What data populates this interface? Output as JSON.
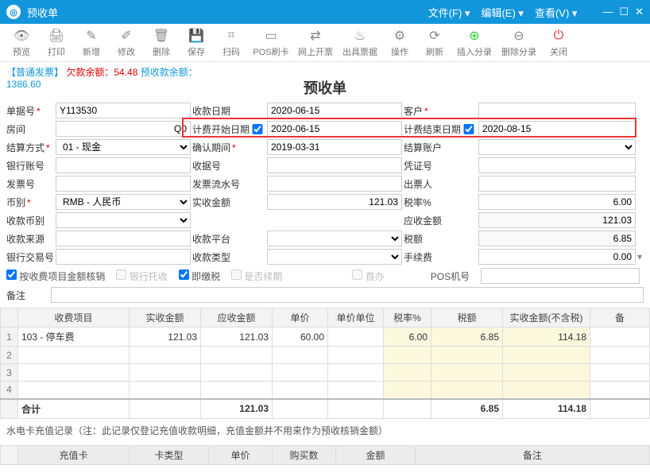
{
  "window": {
    "title": "预收单"
  },
  "menus": {
    "file": "文件(F)",
    "edit": "编辑(E)",
    "view": "查看(V)"
  },
  "toolbar": {
    "preview": "预览",
    "print": "打印",
    "new": "新增",
    "edit": "修改",
    "del": "删除",
    "save": "保存",
    "scan": "扫码",
    "pos": "POS刷卡",
    "web": "网上开票",
    "receipt": "出具票据",
    "op": "操作",
    "refresh": "刷新",
    "insrow": "插入分录",
    "delrow": "删除分录",
    "close": "关闭"
  },
  "info": {
    "prefix": "【普通发票】",
    "due_label": "欠款余额：",
    "due": "54.48",
    "pre_label": "预收款余额：",
    "pre": "1386.60"
  },
  "page_title": "预收单",
  "labels": {
    "docno": "单据号",
    "recvdate": "收款日期",
    "customer": "客户",
    "room": "房间",
    "billstart": "计费开始日期",
    "billend": "计费结束日期",
    "settle": "结算方式",
    "confirm": "确认期间",
    "acct": "结算账户",
    "bankno": "银行账号",
    "recvno": "收据号",
    "voucher": "凭证号",
    "invno": "发票号",
    "invflow": "发票流水号",
    "issuer": "出票人",
    "currency": "币别",
    "actual": "实收金额",
    "taxrate": "税率%",
    "recvcur": "收款币别",
    "should": "应收金额",
    "taxamt": "税额",
    "source": "收款来源",
    "platform": "收款平台",
    "fee": "手续费",
    "banktxn": "银行交易号",
    "recvtype": "收款类型",
    "posno": "POS机号",
    "remark": "备注"
  },
  "values": {
    "docno": "Y113530",
    "recvdate": "2020-06-15",
    "room": "Q0",
    "billstart": "2020-06-15",
    "billend": "2020-08-15",
    "settle": "01 - 现金",
    "confirm": "2019-03-31",
    "currency": "RMB - 人民币",
    "actual": "121.03",
    "taxrate": "6.00",
    "should": "121.03",
    "taxamt": "6.85",
    "fee": "0.00"
  },
  "checks": {
    "byitem": "按收费项目金额核销",
    "banktuo": "银行托收",
    "instant": "即缴税",
    "renew": "是否续期",
    "first": "首办"
  },
  "grid": {
    "headers": {
      "item": "收费项目",
      "actual": "实收金额",
      "should": "应收金额",
      "price": "单价",
      "unit": "单价单位",
      "rate": "税率%",
      "tax": "税额",
      "notax": "实收金额(不含税)",
      "remark": "备"
    },
    "rows": [
      {
        "item": "103 - 停车费",
        "actual": "121.03",
        "should": "121.03",
        "price": "60.00",
        "unit": "",
        "rate": "6.00",
        "tax": "6.85",
        "notax": "114.18"
      }
    ],
    "total_label": "合计",
    "totals": {
      "should": "121.03",
      "tax": "6.85",
      "notax": "114.18"
    }
  },
  "note": "水电卡充值记录（注：此记录仅登记充值收款明细，充值金额并不用来作为预收核销金额）",
  "grid2": {
    "headers": {
      "card": "充值卡",
      "type": "卡类型",
      "price": "单价",
      "qty": "购买数",
      "amount": "金额",
      "remark": "备注"
    }
  }
}
